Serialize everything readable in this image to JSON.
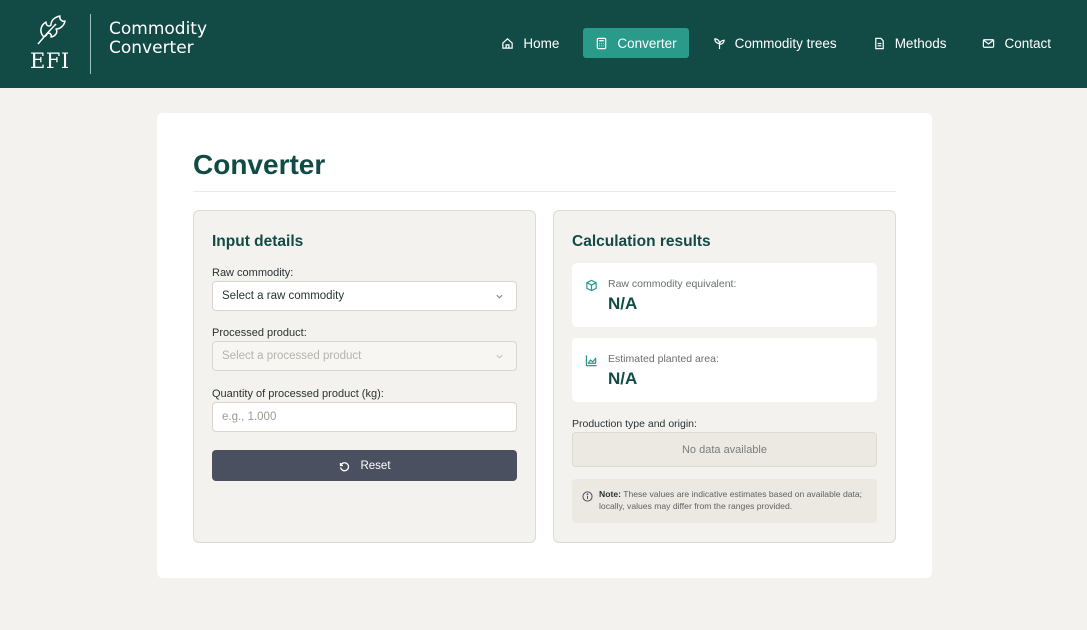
{
  "header": {
    "logo_text": "EFI",
    "app_title": "Commodity Converter",
    "nav": [
      {
        "label": "Home",
        "icon": "home-icon",
        "active": false
      },
      {
        "label": "Converter",
        "icon": "calculator-icon",
        "active": true
      },
      {
        "label": "Commodity trees",
        "icon": "sprout-icon",
        "active": false
      },
      {
        "label": "Methods",
        "icon": "document-icon",
        "active": false
      },
      {
        "label": "Contact",
        "icon": "mail-icon",
        "active": false
      }
    ]
  },
  "main": {
    "title": "Converter",
    "input_panel": {
      "title": "Input details",
      "raw_commodity_label": "Raw commodity:",
      "raw_commodity_value": "Select a raw commodity",
      "processed_product_label": "Processed product:",
      "processed_product_value": "Select a processed product",
      "quantity_label": "Quantity of processed product (kg):",
      "quantity_placeholder": "e.g., 1.000",
      "quantity_value": "",
      "reset_label": "Reset"
    },
    "results_panel": {
      "title": "Calculation results",
      "raw_equivalent_label": "Raw commodity equivalent:",
      "raw_equivalent_value": "N/A",
      "planted_area_label": "Estimated planted area:",
      "planted_area_value": "N/A",
      "production_label": "Production type and origin:",
      "production_value": "No data available",
      "note_bold": "Note:",
      "note_text": " These values are indicative estimates based on available data; locally, values may differ from the ranges provided."
    }
  },
  "colors": {
    "header_bg": "#124b46",
    "accent": "#2a9a8b",
    "reset_button": "#4a5060"
  }
}
